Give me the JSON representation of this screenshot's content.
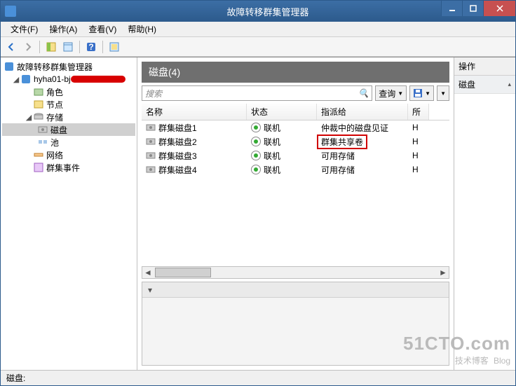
{
  "window": {
    "title": "故障转移群集管理器"
  },
  "menu": {
    "file": "文件(F)",
    "action": "操作(A)",
    "view": "查看(V)",
    "help": "帮助(H)"
  },
  "tree": {
    "root": "故障转移群集管理器",
    "cluster": "hyha01-bj",
    "roles": "角色",
    "nodes": "节点",
    "storage": "存储",
    "disks": "磁盘",
    "pools": "池",
    "networks": "网络",
    "events": "群集事件"
  },
  "content": {
    "header": "磁盘(4)",
    "search_placeholder": "搜索",
    "query_btn": "查询",
    "columns": {
      "name": "名称",
      "status": "状态",
      "assigned": "指派给",
      "owner": "所"
    },
    "rows": [
      {
        "name": "群集磁盘1",
        "status": "联机",
        "assigned": "仲裁中的磁盘见证",
        "owner": "H"
      },
      {
        "name": "群集磁盘2",
        "status": "联机",
        "assigned": "群集共享卷",
        "owner": "H",
        "highlight": true
      },
      {
        "name": "群集磁盘3",
        "status": "联机",
        "assigned": "可用存储",
        "owner": "H"
      },
      {
        "name": "群集磁盘4",
        "status": "联机",
        "assigned": "可用存储",
        "owner": "H"
      }
    ]
  },
  "actions": {
    "title": "操作",
    "section": "磁盘"
  },
  "statusbar": {
    "label": "磁盘:"
  },
  "watermark": {
    "line1": "51CTO.com",
    "line2": "技术博客",
    "badge": "Blog"
  }
}
